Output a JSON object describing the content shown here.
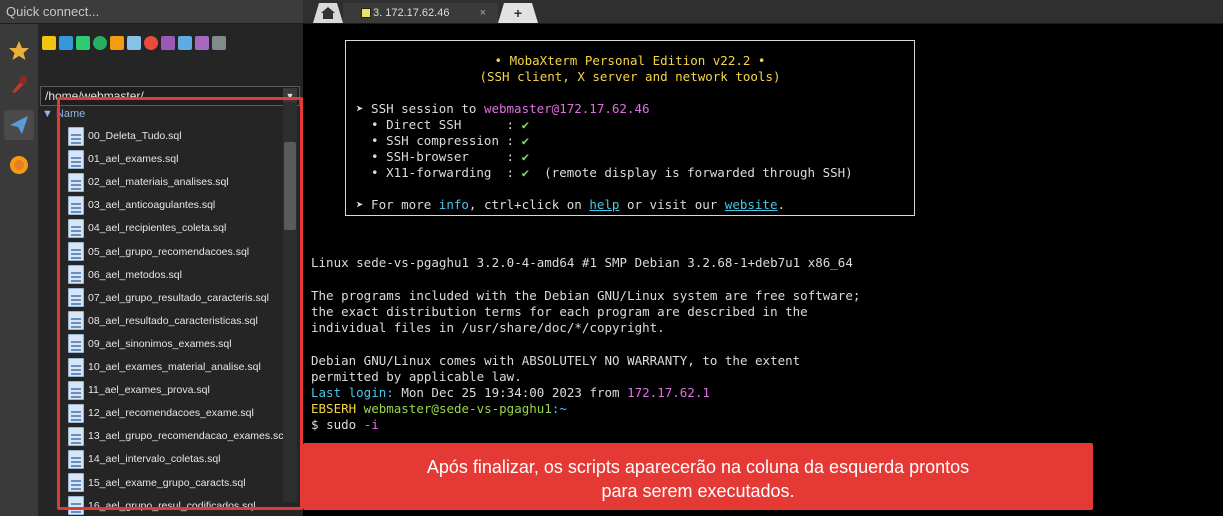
{
  "quick_connect": {
    "placeholder": "Quick connect..."
  },
  "file_panel": {
    "path": "/home/webmaster/",
    "column_header": "Name",
    "files": [
      "00_Deleta_Tudo.sql",
      "01_ael_exames.sql",
      "02_ael_materiais_analises.sql",
      "03_ael_anticoagulantes.sql",
      "04_ael_recipientes_coleta.sql",
      "05_ael_grupo_recomendacoes.sql",
      "06_ael_metodos.sql",
      "07_ael_grupo_resultado_caracteris.sql",
      "08_ael_resultado_caracteristicas.sql",
      "09_ael_sinonimos_exames.sql",
      "10_ael_exames_material_analise.sql",
      "11_ael_exames_prova.sql",
      "12_ael_recomendacoes_exame.sql",
      "13_ael_grupo_recomendacao_exames.sc",
      "14_ael_intervalo_coletas.sql",
      "15_ael_exame_grupo_caracts.sql",
      "16_ael_grupo_resul_codificados.sql"
    ]
  },
  "tabs": {
    "session_label": "3. 172.17.62.46",
    "close": "×",
    "plus": "+"
  },
  "terminal": {
    "banner": {
      "title": "• MobaXterm Personal Edition v22.2 •",
      "subtitle": "(SSH client, X server and network tools)",
      "session_prefix": "➤ SSH session to ",
      "session_target": "webmaster@172.17.62.46",
      "features": [
        {
          "label": "  • Direct SSH      : ",
          "mark": "✔",
          "note": ""
        },
        {
          "label": "  • SSH compression : ",
          "mark": "✔",
          "note": ""
        },
        {
          "label": "  • SSH-browser     : ",
          "mark": "✔",
          "note": ""
        },
        {
          "label": "  • X11-forwarding  : ",
          "mark": "✔",
          "note": "  (remote display is forwarded through SSH)"
        }
      ],
      "info_prefix": "➤ For more ",
      "info_word": "info",
      "info_mid": ", ctrl+click on ",
      "help_word": "help",
      "info_mid2": " or visit our ",
      "website_word": "website",
      "info_end": "."
    },
    "lines": {
      "uname": "Linux sede-vs-pgaghu1 3.2.0-4-amd64 #1 SMP Debian 3.2.68-1+deb7u1 x86_64",
      "p1": "The programs included with the Debian GNU/Linux system are free software;",
      "p2": "the exact distribution terms for each program are described in the",
      "p3": "individual files in /usr/share/doc/*/copyright.",
      "w1": "Debian GNU/Linux comes with ABSOLUTELY NO WARRANTY, to the extent",
      "w2": "permitted by applicable law.",
      "last_login_label": "Last login:",
      "last_login_value": " Mon Dec 25 19:34:00 2023 from ",
      "last_login_ip": "172.17.62.1",
      "prompt_host": "EBSERH",
      "prompt_user": " webmaster@sede-vs-pgaghu1",
      "prompt_path": ":~",
      "cmd_prompt": "$ ",
      "cmd_text": "sudo ",
      "cmd_flag": "-i"
    }
  },
  "toast": {
    "line1": "Após finalizar, os scripts aparecerão na coluna da esquerda prontos",
    "line2": "para serem executados."
  }
}
